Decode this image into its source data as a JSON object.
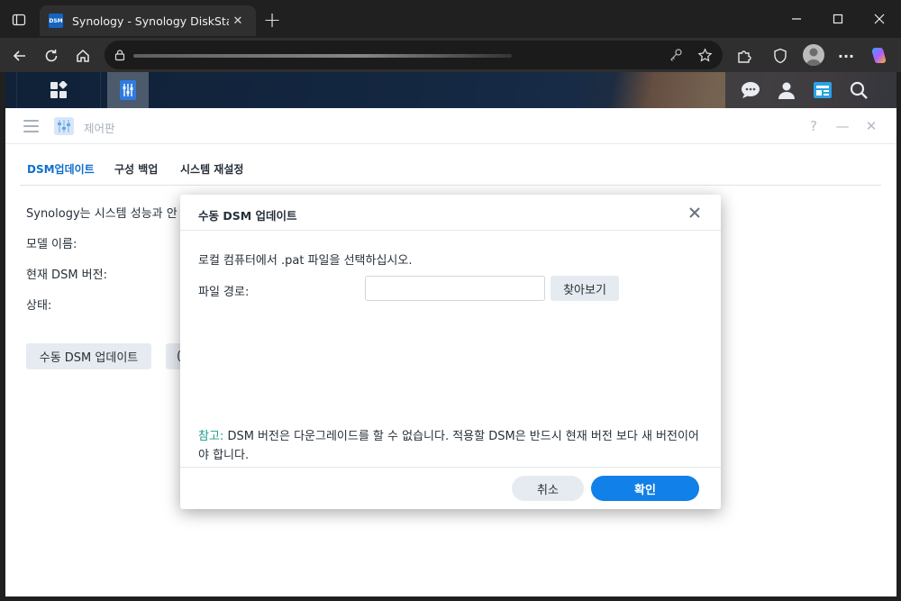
{
  "browser": {
    "tab_title": "Synology - Synology DiskStation",
    "favicon_text": "DSM",
    "new_tab_symbol": "+",
    "close_symbol": "✕",
    "menu_symbol": "···"
  },
  "dsm": {
    "window_title": "제어판",
    "window_controls": {
      "help": "?",
      "minimize": "—",
      "close": "✕"
    },
    "tabs": [
      {
        "label": "DSM업데이트",
        "active": true
      },
      {
        "label": "구성 백업",
        "active": false
      },
      {
        "label": "시스템 재설정",
        "active": false
      }
    ],
    "content": {
      "intro": "Synology는 시스템 성능과 안",
      "model_label": "모델 이름:",
      "version_label": "현재 DSM 버전:",
      "status_label": "상태:"
    },
    "buttons": {
      "manual_update": "수동 DSM 업데이트",
      "second_partial": "("
    }
  },
  "dialog": {
    "title": "수동 DSM 업데이트",
    "description": "로컬 컴퓨터에서 .pat 파일을 선택하십시오.",
    "file_path_label": "파일 경로:",
    "file_path_value": "",
    "browse_button": "찾아보기",
    "note_key": "참고:",
    "note_text": " DSM 버전은 다운그레이드를 할 수 없습니다. 적용할 DSM은 반드시 현재 버전 보다 새 버전이어야 합니다.",
    "cancel_button": "취소",
    "ok_button": "확인"
  },
  "colors": {
    "accent_blue": "#1180e8",
    "active_tab": "#0f6ecf",
    "note_teal": "#1a9a8c"
  }
}
